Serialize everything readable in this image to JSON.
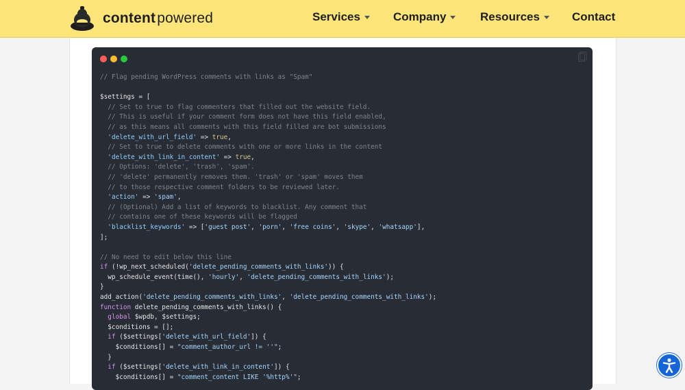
{
  "header": {
    "logo_bold": "content",
    "logo_light": "powered",
    "nav": [
      {
        "label": "Services",
        "has_caret": true
      },
      {
        "label": "Company",
        "has_caret": true
      },
      {
        "label": "Resources",
        "has_caret": true
      },
      {
        "label": "Contact",
        "has_caret": false
      }
    ]
  },
  "icons": {
    "logo": "sumo-mascot-icon",
    "copy": "copy-icon",
    "accessibility": "accessibility-icon"
  },
  "colors": {
    "header_bg": "#fde57a",
    "code_bg": "#282c34",
    "accessibility_button": "#1565d8"
  },
  "code": {
    "lines": [
      [
        [
          "c",
          "// Flag pending WordPress comments with links as \"Spam\""
        ]
      ],
      [],
      [
        [
          "p",
          "$settings = ["
        ]
      ],
      [
        [
          "c",
          "  // Set to true to flag commenters that filled out the website field."
        ]
      ],
      [
        [
          "c",
          "  // This is useful if your comment form does not have this field enabled,"
        ]
      ],
      [
        [
          "c",
          "  // as this means all comments with this field filled are bot submissions"
        ]
      ],
      [
        [
          "p",
          "  "
        ],
        [
          "k",
          "'delete_with_url_field'"
        ],
        [
          "p",
          " => "
        ],
        [
          "b",
          "true"
        ],
        [
          "p",
          ","
        ]
      ],
      [
        [
          "c",
          "  // Set to true to delete comments with one or more links in the content"
        ]
      ],
      [
        [
          "p",
          "  "
        ],
        [
          "k",
          "'delete_with_link_in_content'"
        ],
        [
          "p",
          " => "
        ],
        [
          "b",
          "true"
        ],
        [
          "p",
          ","
        ]
      ],
      [
        [
          "c",
          "  // Options: 'delete', 'trash', 'spam'."
        ]
      ],
      [
        [
          "c",
          "  // 'delete' permanently removes them. 'trash' or 'spam' moves them"
        ]
      ],
      [
        [
          "c",
          "  // to those respective comment folders to be reviewed later."
        ]
      ],
      [
        [
          "p",
          "  "
        ],
        [
          "k",
          "'action'"
        ],
        [
          "p",
          " => "
        ],
        [
          "s",
          "'spam'"
        ],
        [
          "p",
          ","
        ]
      ],
      [
        [
          "c",
          "  // (Optional) Add a list of keywords to blacklist. Any comment that"
        ]
      ],
      [
        [
          "c",
          "  // contains one of these keywords will be flagged"
        ]
      ],
      [
        [
          "p",
          "  "
        ],
        [
          "k",
          "'blacklist_keywords'"
        ],
        [
          "p",
          " => ["
        ],
        [
          "s",
          "'guest post'"
        ],
        [
          "p",
          ", "
        ],
        [
          "s",
          "'porn'"
        ],
        [
          "p",
          ", "
        ],
        [
          "s",
          "'free coins'"
        ],
        [
          "p",
          ", "
        ],
        [
          "s",
          "'skype'"
        ],
        [
          "p",
          ", "
        ],
        [
          "s",
          "'whatsapp'"
        ],
        [
          "p",
          "],"
        ]
      ],
      [
        [
          "p",
          "];"
        ]
      ],
      [],
      [
        [
          "c",
          "// No need to edit below this line"
        ]
      ],
      [
        [
          "w",
          "if"
        ],
        [
          "p",
          " (!wp_next_scheduled("
        ],
        [
          "s",
          "'delete_pending_comments_with_links'"
        ],
        [
          "p",
          ")) {"
        ]
      ],
      [
        [
          "p",
          "  wp_schedule_event(time(), "
        ],
        [
          "s",
          "'hourly'"
        ],
        [
          "p",
          ", "
        ],
        [
          "s",
          "'delete_pending_comments_with_links'"
        ],
        [
          "p",
          ");"
        ]
      ],
      [
        [
          "p",
          "}"
        ]
      ],
      [
        [
          "p",
          "add_action("
        ],
        [
          "s",
          "'delete_pending_comments_with_links'"
        ],
        [
          "p",
          ", "
        ],
        [
          "s",
          "'delete_pending_comments_with_links'"
        ],
        [
          "p",
          ");"
        ]
      ],
      [
        [
          "w",
          "function"
        ],
        [
          "p",
          " delete_pending_comments_with_links() {"
        ]
      ],
      [
        [
          "p",
          "  "
        ],
        [
          "w",
          "global"
        ],
        [
          "p",
          " $wpdb, $settings;"
        ]
      ],
      [
        [
          "p",
          "  $conditions = [];"
        ]
      ],
      [
        [
          "p",
          "  "
        ],
        [
          "w",
          "if"
        ],
        [
          "p",
          " ($settings["
        ],
        [
          "s",
          "'delete_with_url_field'"
        ],
        [
          "p",
          "]) {"
        ]
      ],
      [
        [
          "p",
          "    $conditions[] = "
        ],
        [
          "s",
          "\"comment_author_url != ''\""
        ],
        [
          "p",
          ";"
        ]
      ],
      [
        [
          "p",
          "  }"
        ]
      ],
      [
        [
          "p",
          "  "
        ],
        [
          "w",
          "if"
        ],
        [
          "p",
          " ($settings["
        ],
        [
          "s",
          "'delete_with_link_in_content'"
        ],
        [
          "p",
          "]) {"
        ]
      ],
      [
        [
          "p",
          "    $conditions[] = "
        ],
        [
          "s",
          "\"comment_content LIKE '%http%'\""
        ],
        [
          "p",
          ";"
        ]
      ]
    ]
  }
}
